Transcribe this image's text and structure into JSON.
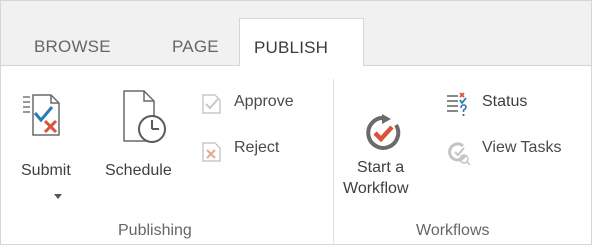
{
  "tabs": [
    {
      "label": "BROWSE",
      "active": false
    },
    {
      "label": "PAGE",
      "active": false
    },
    {
      "label": "PUBLISH",
      "active": true
    }
  ],
  "publishing": {
    "group_label": "Publishing",
    "submit_label": "Submit",
    "schedule_label": "Schedule",
    "approve_label": "Approve",
    "reject_label": "Reject"
  },
  "workflows": {
    "group_label": "Workflows",
    "start_line1": "Start a",
    "start_line2": "Workflow",
    "status_label": "Status",
    "view_tasks_label": "View Tasks"
  },
  "icons": {
    "submit": "submit-document-icon",
    "schedule": "schedule-clock-icon",
    "approve": "approve-check-icon",
    "reject": "reject-x-icon",
    "start_workflow": "start-workflow-icon",
    "status": "workflow-status-icon",
    "view_tasks": "view-tasks-icon"
  },
  "colors": {
    "accent_red": "#d9533a",
    "accent_blue": "#2a7ab9",
    "tab_bg": "#f1f1f1"
  }
}
